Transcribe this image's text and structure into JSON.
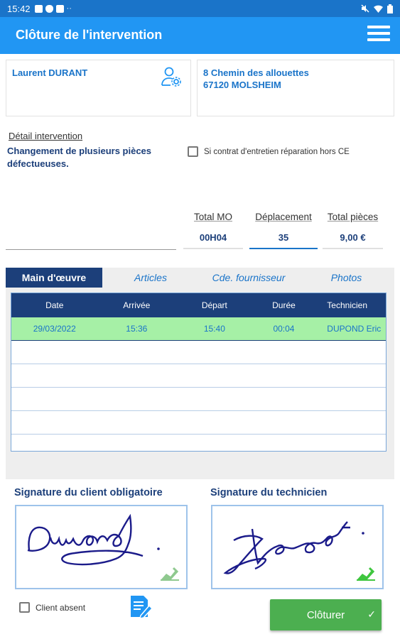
{
  "status_bar": {
    "time": "15:42",
    "dots": "··"
  },
  "app_bar": {
    "title": "Clôture de l'intervention"
  },
  "client": {
    "name": "Laurent DURANT",
    "address_line1": "8 Chemin des allouettes",
    "address_line2": "67120 MOLSHEIM"
  },
  "detail": {
    "label": "Détail intervention",
    "text": "Changement de plusieurs pièces défectueuses.",
    "contract_checkbox_label": "Si contrat d'entretien réparation hors CE",
    "contract_checked": false
  },
  "totals": {
    "mo_label": "Total MO",
    "mo_value": "00H04",
    "deplacement_label": "Déplacement",
    "deplacement_value": "35",
    "pieces_label": "Total pièces",
    "pieces_value": "9,00 €"
  },
  "tabs": [
    {
      "label": "Main d'œuvre",
      "active": true
    },
    {
      "label": "Articles",
      "active": false
    },
    {
      "label": "Cde. fournisseur",
      "active": false
    },
    {
      "label": "Photos",
      "active": false
    }
  ],
  "table": {
    "columns": [
      "Date",
      "Arrivée",
      "Départ",
      "Durée",
      "Technicien"
    ],
    "rows": [
      {
        "date": "29/03/2022",
        "arrivee": "15:36",
        "depart": "15:40",
        "duree": "00:04",
        "technicien": "DUPOND Eric"
      }
    ]
  },
  "signatures": {
    "client_label": "Signature du client obligatoire",
    "tech_label": "Signature du technicien"
  },
  "client_absent": {
    "label": "Client absent",
    "checked": false
  },
  "close_button": {
    "label": "Clôturer",
    "icon": "check-icon"
  },
  "colors": {
    "primary": "#2196f3",
    "navy": "#1c3f7a",
    "green": "#4caf50",
    "row_selected": "#a6f0a6"
  }
}
